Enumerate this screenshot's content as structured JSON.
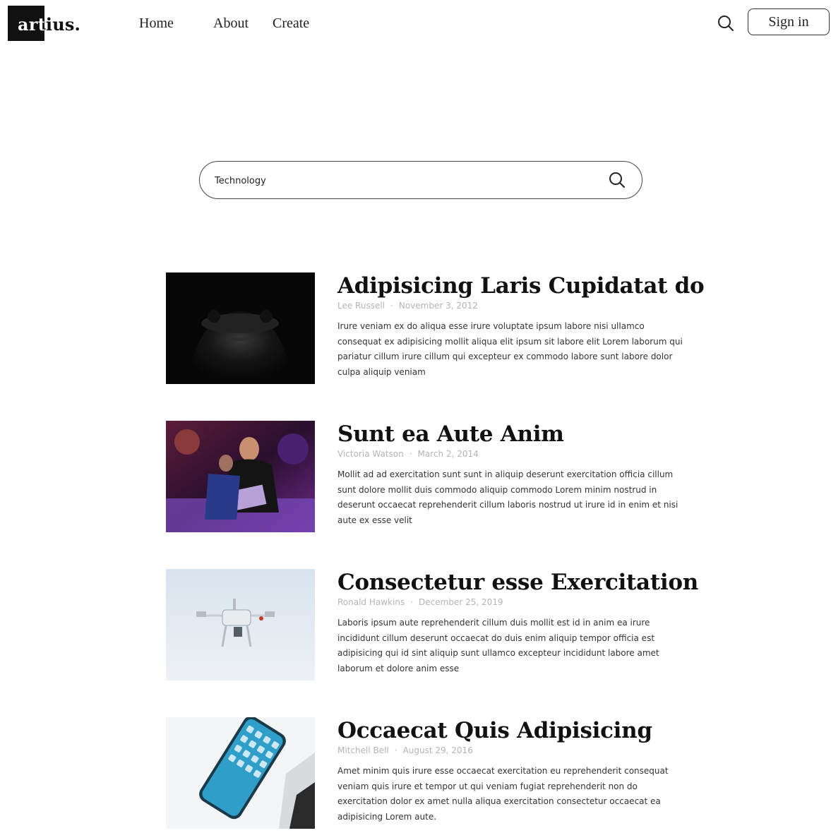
{
  "brand": {
    "logo": "artius."
  },
  "nav": {
    "home": "Home",
    "about": "About",
    "create": "Create",
    "sign_in": "Sign in"
  },
  "search": {
    "value": "Technology",
    "placeholder": "Technology"
  },
  "articles": [
    {
      "title": "Adipisicing Laris Cupidatat do",
      "author": "Lee Russell",
      "date": "November 3, 2012",
      "excerpt": "Irure veniam ex do aliqua esse irure voluptate ipsum labore nisi ullamco consequat ex adipisicing mollit aliqua elit ipsum sit labore elit Lorem laborum qui pariatur cillum irure cillum qui excepteur ex commodo labore sunt labore dolor culpa aliquip veniam",
      "image": "game-controller-image"
    },
    {
      "title": "Sunt ea Aute Anim",
      "author": "Victoria Watson",
      "date": "March 2, 2014",
      "excerpt": "Mollit ad ad exercitation sunt sunt in aliquip deserunt exercitation officia cillum sunt dolore mollit duis commodo aliquip commodo Lorem minim nostrud in deserunt occaecat reprehenderit cillum laboris nostrud ut irure id in enim et nisi aute ex esse velit",
      "image": "laptop-event-image"
    },
    {
      "title": "Consectetur esse Exercitation",
      "author": "Ronald Hawkins",
      "date": "December 25, 2019",
      "excerpt": "Laboris ipsum aute reprehenderit cillum duis mollit est id in anim ea irure incididunt cillum deserunt occaecat do duis enim aliquip tempor officia est adipisicing qui id sint aliquip sunt ullamco excepteur incididunt labore amet laborum et dolore anim esse",
      "image": "drone-image"
    },
    {
      "title": "Occaecat Quis Adipisicing",
      "author": "Mitchell Bell",
      "date": "August 29, 2016",
      "excerpt": "Amet minim quis irure esse occaecat exercitation eu reprehenderit consequat veniam quis irure et tempor ut qui veniam fugiat reprehenderit non do exercitation dolor ex amet nulla aliqua exercitation consectetur occaecat ea adipisicing Lorem aute.",
      "image": "smartphone-image"
    }
  ],
  "icons": {
    "search": "search-icon"
  },
  "colors": {
    "text": "#111111",
    "meta": "#b4b4b4",
    "logo_block": "#111111"
  }
}
